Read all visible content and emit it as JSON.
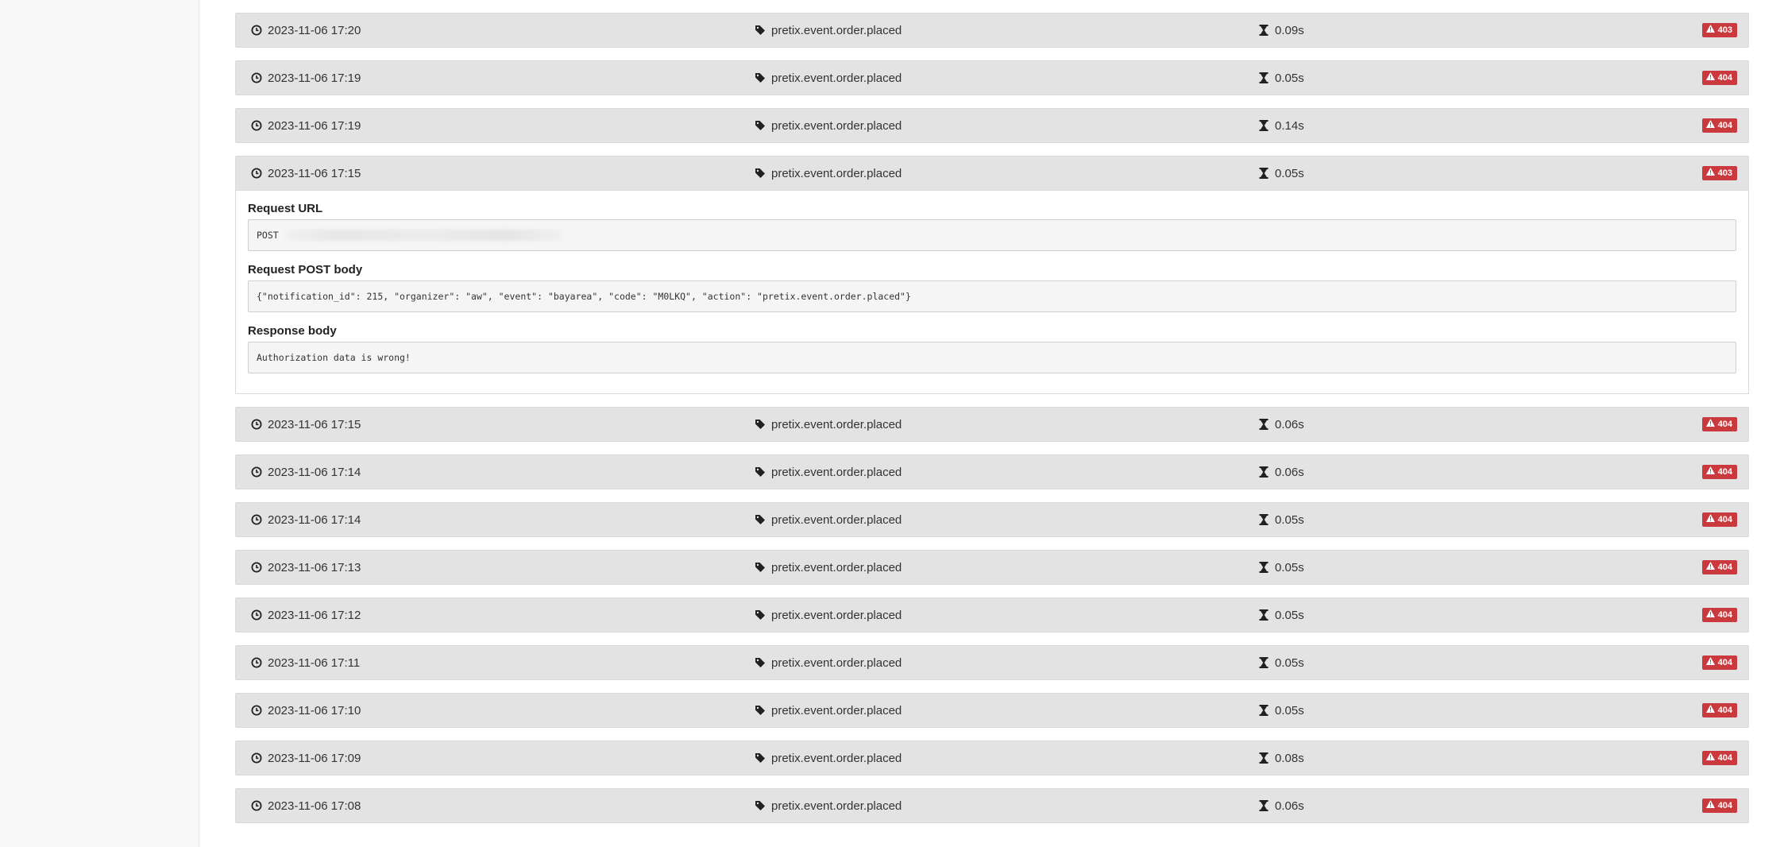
{
  "webhook_log": {
    "rows_before": [
      {
        "time": "2023-11-06 17:20",
        "action": "pretix.event.order.placed",
        "duration": "0.09s",
        "status": "403"
      },
      {
        "time": "2023-11-06 17:19",
        "action": "pretix.event.order.placed",
        "duration": "0.05s",
        "status": "404"
      },
      {
        "time": "2023-11-06 17:19",
        "action": "pretix.event.order.placed",
        "duration": "0.14s",
        "status": "404"
      }
    ],
    "expanded": {
      "time": "2023-11-06 17:15",
      "action": "pretix.event.order.placed",
      "duration": "0.05s",
      "status": "403",
      "request_url_label": "Request URL",
      "request_method": "POST",
      "request_body_label": "Request POST body",
      "request_body": "{\"notification_id\": 215, \"organizer\": \"aw\", \"event\": \"bayarea\", \"code\": \"M0LKQ\", \"action\": \"pretix.event.order.placed\"}",
      "response_body_label": "Response body",
      "response_body": "Authorization data is wrong!"
    },
    "rows_after": [
      {
        "time": "2023-11-06 17:15",
        "action": "pretix.event.order.placed",
        "duration": "0.06s",
        "status": "404"
      },
      {
        "time": "2023-11-06 17:14",
        "action": "pretix.event.order.placed",
        "duration": "0.06s",
        "status": "404"
      },
      {
        "time": "2023-11-06 17:14",
        "action": "pretix.event.order.placed",
        "duration": "0.05s",
        "status": "404"
      },
      {
        "time": "2023-11-06 17:13",
        "action": "pretix.event.order.placed",
        "duration": "0.05s",
        "status": "404"
      },
      {
        "time": "2023-11-06 17:12",
        "action": "pretix.event.order.placed",
        "duration": "0.05s",
        "status": "404"
      },
      {
        "time": "2023-11-06 17:11",
        "action": "pretix.event.order.placed",
        "duration": "0.05s",
        "status": "404"
      },
      {
        "time": "2023-11-06 17:10",
        "action": "pretix.event.order.placed",
        "duration": "0.05s",
        "status": "404"
      },
      {
        "time": "2023-11-06 17:09",
        "action": "pretix.event.order.placed",
        "duration": "0.08s",
        "status": "404"
      },
      {
        "time": "2023-11-06 17:08",
        "action": "pretix.event.order.placed",
        "duration": "0.06s",
        "status": "404"
      }
    ]
  },
  "icons": {
    "time": "clock-icon",
    "action": "tag-icon",
    "duration": "hourglass-icon",
    "status": "warning-icon"
  },
  "colors": {
    "row_bg": "#e3e3e3",
    "error_badge": "#c9393e",
    "sidebar_bg": "#f8f8f8"
  }
}
